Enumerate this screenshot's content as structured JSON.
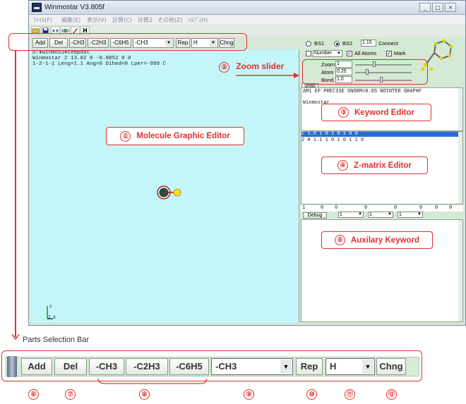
{
  "window": {
    "title": "Winmostar V3.805f",
    "controls": {
      "minimize": "_",
      "maximize": "□",
      "close": "×"
    }
  },
  "menu": [
    "ﾌｧｲﾙ(F)",
    "編集(E)",
    "表示(V)",
    "計算(C)",
    "計算2",
    "その他(Z)",
    "ﾍﾙﾌﾟ(H)"
  ],
  "toolbar": {
    "icons": [
      "open-folder-icon",
      "save-disk-icon",
      "arrows-icon",
      "atom-icon",
      "brush-icon",
      "help-icon"
    ],
    "help_label": "H"
  },
  "parts_bar": {
    "add": "Add",
    "del": "Del",
    "ch3": "-CH3",
    "c2h3": "-C2H3",
    "c6h5": "-C6H5",
    "group_select": "-CH3",
    "rep": "Rep",
    "atom_select": "H",
    "chng": "Chng"
  },
  "graphic": {
    "line1": "D:¥winmos3¥tempdat",
    "line2": "Winmostar  2  13.02  0  -0.0852  0  0",
    "line3": "1-2-1-1  Leng=1.1  Ang=0  Dihed=0  Lper=-999  C",
    "axis_y": "Y",
    "axis_zx": "Z   X"
  },
  "right": {
    "bs1": "BS1",
    "bs2": "BS2",
    "scale_value": "1.15",
    "connect": "Connect",
    "number_select": "Number",
    "all_atoms": "All Atoms",
    "mark": "Mark",
    "zoom_label": "Zoom",
    "zoom_value": "1",
    "atom_label": "Atom",
    "atom_value": "0.25",
    "bond_label": "Bond",
    "bond_value": "1.0",
    "undo": "undo",
    "keyword": "AM1 EF PRECISE GNORM=0.05 NOINTER GRAPHF",
    "keyword_title": "Winmostar",
    "zmat_row1": "C    1.0         1    0           1    0           1    0    0",
    "zmat_row2": "2  H  1.1         1    0           1    0           1    1    0",
    "numfields": [
      "1",
      "0",
      "0",
      "0",
      "0",
      "0",
      "0",
      "0"
    ],
    "debug": "Debug",
    "debug_values": [
      "1",
      "1",
      "1"
    ]
  },
  "annotations": {
    "zoom_slider": "Zoom slider",
    "molecule_editor": "Molecule Graphic Editor",
    "keyword_editor": "Keyword Editor",
    "zmatrix_editor": "Z-matrix  Editor",
    "auxiliary_keyword": "Auxilary Keyword",
    "parts_selection_bar": "Parts Selection Bar",
    "n1": "①",
    "n2": "②",
    "n3": "③",
    "n4": "④",
    "n5": "⑤",
    "n6": "⑥",
    "n7": "⑦",
    "n8": "⑧",
    "n9": "⑨",
    "n10": "⑩",
    "n11": "⑪",
    "n12": "⑫"
  },
  "colors": {
    "annotation": "#e03030",
    "graphic_bg": "#c4f6f9",
    "panel_bg": "#d4ead4",
    "selected_row": "#2a6ad8"
  }
}
